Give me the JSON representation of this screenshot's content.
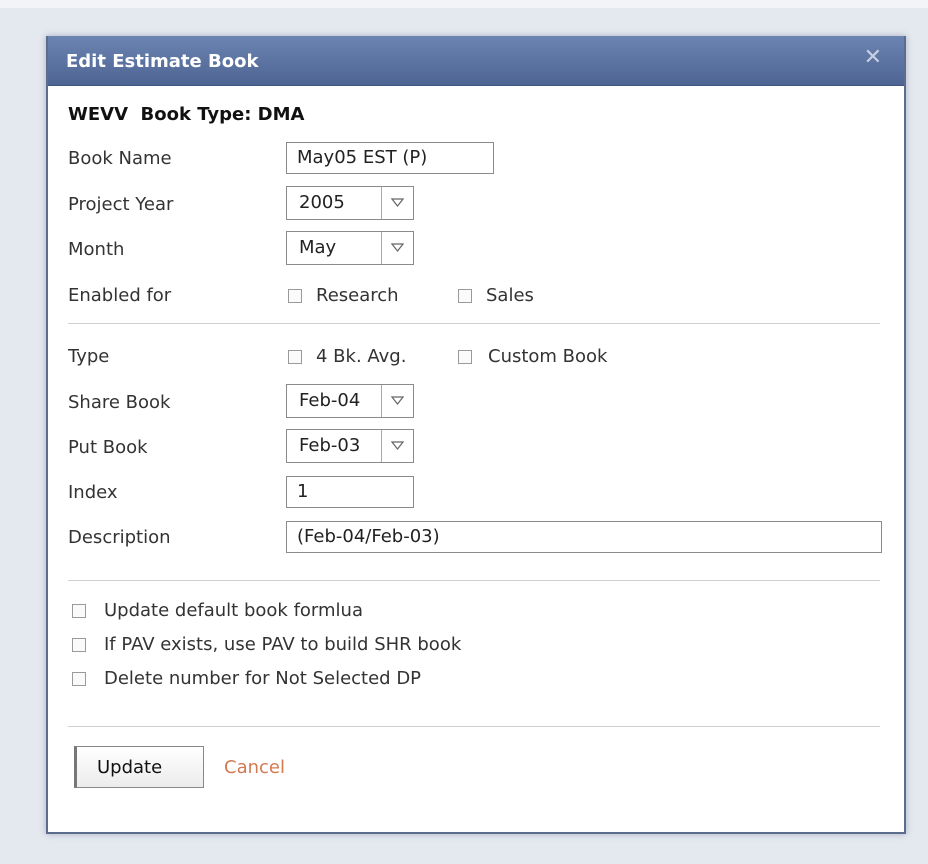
{
  "dialog": {
    "title": "Edit Estimate Book",
    "heading": "WEVV  Book Type: DMA"
  },
  "form": {
    "book_name": {
      "label": "Book Name",
      "value": "May05 EST (P)"
    },
    "project_year": {
      "label": "Project Year",
      "value": "2005"
    },
    "month": {
      "label": "Month",
      "value": "May"
    },
    "enabled_for": {
      "label": "Enabled for",
      "options": [
        {
          "label": "Research",
          "checked": false
        },
        {
          "label": "Sales",
          "checked": false
        }
      ]
    },
    "type": {
      "label": "Type",
      "options": [
        {
          "label": "4 Bk. Avg.",
          "checked": false
        },
        {
          "label": "Custom Book",
          "checked": false
        }
      ]
    },
    "share_book": {
      "label": "Share Book",
      "value": "Feb-04"
    },
    "put_book": {
      "label": "Put Book",
      "value": "Feb-03"
    },
    "index": {
      "label": "Index",
      "value": "1"
    },
    "description": {
      "label": "Description",
      "value": "(Feb-04/Feb-03)"
    }
  },
  "options": [
    {
      "label": "Update default book formlua",
      "checked": false
    },
    {
      "label": "If PAV exists, use PAV to build SHR book",
      "checked": false
    },
    {
      "label": "Delete number for Not Selected DP",
      "checked": false
    }
  ],
  "actions": {
    "update_label": "Update",
    "cancel_label": "Cancel"
  },
  "icons": {
    "close": "close-icon",
    "dropdown": "triangle-down-icon"
  },
  "colors": {
    "titlebar": "#5a71a2",
    "cancel_link": "#d27a52"
  }
}
